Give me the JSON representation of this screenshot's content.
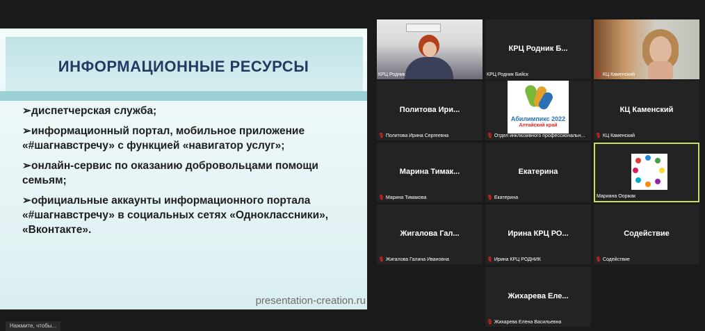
{
  "slide": {
    "title": "ИНФОРМАЦИОННЫЕ РЕСУРСЫ",
    "bullets": [
      "➢диспетчерская служба;",
      "➢информационный портал, мобильное приложение «#шагнавстречу» с функцией «навигатор услуг»;",
      "➢онлайн-сервис по оказанию добровольцами помощи семьям;",
      "➢официальные аккаунты информационного портала «#шагнавстречу» в социальных сетях «Одноклассники», «Вконтакте»."
    ],
    "footer": "presentation-creation.ru"
  },
  "bottom_hint": "Нажмите, чтобы...",
  "participants": [
    {
      "big": "",
      "name": "КРЦ Родник",
      "muted": false
    },
    {
      "big": "КРЦ Родник Б...",
      "name": "КРЦ Родник Бийск",
      "muted": false
    },
    {
      "big": "",
      "name": "КЦ Каменский",
      "muted": true
    },
    {
      "big": "Политова Ири...",
      "name": "Политова Ирина Сергеевна",
      "muted": true
    },
    {
      "big": "",
      "name": "Отдел инклюзивного профессиональн...",
      "muted": true
    },
    {
      "big": "КЦ Каменский",
      "name": "КЦ Каменский",
      "muted": true
    },
    {
      "big": "Марина Тимак...",
      "name": "Марина Тимакова",
      "muted": true
    },
    {
      "big": "Екатерина",
      "name": "Екатерина",
      "muted": true
    },
    {
      "big": "",
      "name": "Мариана Ооржак",
      "muted": false
    },
    {
      "big": "Жигалова Гал...",
      "name": "Жигалова Галина Ивановна",
      "muted": true
    },
    {
      "big": "Ирина КРЦ РО...",
      "name": "Ирина КРЦ РОДНИК",
      "muted": true
    },
    {
      "big": "Содействие",
      "name": "Содействие",
      "muted": true
    },
    {
      "big": "Жихарева Еле...",
      "name": "Жихарева Елена Васильевна",
      "muted": true
    }
  ],
  "logo": {
    "line1": "Абилимпикс 2022",
    "line2": "Алтайский край"
  },
  "sign_text": "#ШАГНАВСТРЕЧУ",
  "colors": {
    "active_border": "#c9e05b",
    "muted_icon": "#e02424",
    "slide_title": "#233a63"
  },
  "icons": {
    "mic_muted": "mic-muted-icon"
  }
}
